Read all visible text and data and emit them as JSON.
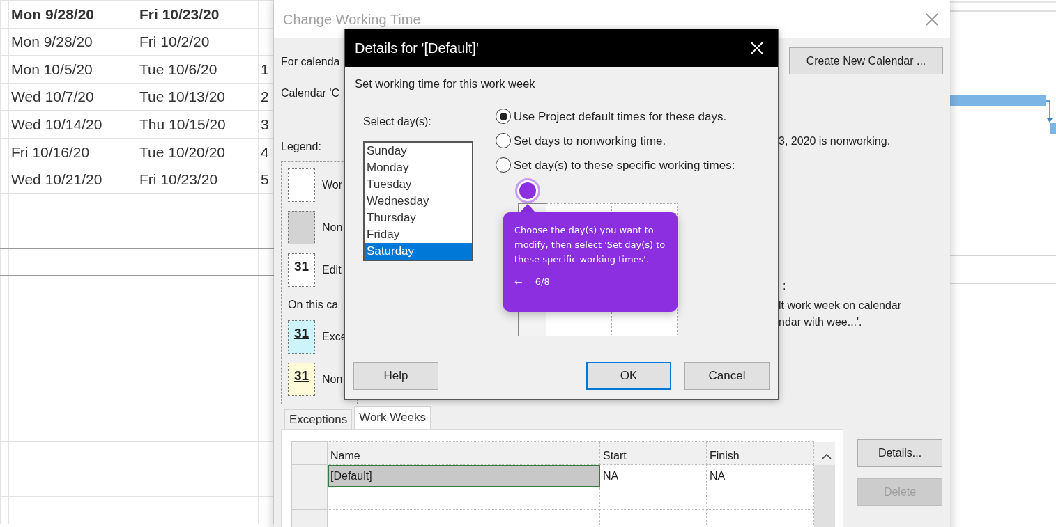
{
  "spreadsheet": {
    "rows": [
      {
        "column_1": "Mon 9/28/20",
        "column_2": "Fri 10/23/20",
        "bold": true
      },
      {
        "column_1": "Mon 9/28/20",
        "column_2": "Fri 10/2/20",
        "bold": false
      },
      {
        "column_1": "Mon 10/5/20",
        "column_2": "Tue 10/6/20",
        "column_3": "1",
        "bold": false
      },
      {
        "column_1": "Wed 10/7/20",
        "column_2": "Tue 10/13/20",
        "column_3": "2",
        "bold": false
      },
      {
        "column_1": "Wed 10/14/20",
        "column_2": "Thu 10/15/20",
        "column_3": "3",
        "bold": false
      },
      {
        "column_1": "Fri 10/16/20",
        "column_2": "Tue 10/20/20",
        "column_3": "4",
        "bold": false
      },
      {
        "column_1": "Wed 10/21/20",
        "column_2": "Fri 10/23/20",
        "column_3": "5",
        "bold": false
      }
    ]
  },
  "change_working_time": {
    "title": "Change Working Time",
    "active": false,
    "for_calendar_label": "For calenda",
    "calendar_note": "Calendar 'C",
    "create_button": "Create New Calendar ...",
    "legend": {
      "title": "Legend:",
      "items": [
        {
          "kind": "working",
          "label": "Wor"
        },
        {
          "kind": "nonworking",
          "label": "Non"
        },
        {
          "kind": "edited",
          "day": "31",
          "label": "Edit"
        }
      ]
    },
    "on_this_calendar": {
      "title": "On this ca",
      "items": [
        {
          "kind": "exception",
          "day": "31",
          "label": "Exce"
        },
        {
          "kind": "nondefault",
          "day": "31",
          "label": "Non"
        }
      ]
    },
    "status_text": "3, 2020 is nonworking.",
    "note_lines": [
      ":",
      "lt work week on calendar",
      "ndar with wee...'."
    ],
    "tabs": [
      {
        "label": "Exceptions",
        "selected": false
      },
      {
        "label": "Work Weeks",
        "selected": true
      }
    ],
    "table": {
      "columns": [
        "Name",
        "Start",
        "Finish"
      ],
      "rows": [
        {
          "name": "[Default]",
          "start": "NA",
          "finish": "NA",
          "selected": true
        }
      ]
    },
    "side_buttons": [
      {
        "label": "Details...",
        "disabled": false
      },
      {
        "label": "Delete",
        "disabled": true
      }
    ]
  },
  "details_dialog": {
    "title": "Details for '[Default]'",
    "section": "Set working time for this work week",
    "select_label": "Select day(s):",
    "days": [
      {
        "label": "Sunday",
        "selected": false
      },
      {
        "label": "Monday",
        "selected": false
      },
      {
        "label": "Tuesday",
        "selected": false
      },
      {
        "label": "Wednesday",
        "selected": false
      },
      {
        "label": "Thursday",
        "selected": false
      },
      {
        "label": "Friday",
        "selected": false
      },
      {
        "label": "Saturday",
        "selected": true
      }
    ],
    "options": [
      {
        "label": "Use Project default times for these days.",
        "selected": true
      },
      {
        "label": "Set days to nonworking time.",
        "selected": false
      },
      {
        "label": "Set day(s) to these specific working times:",
        "selected": false
      }
    ],
    "buttons": [
      {
        "label": "Help",
        "default": false
      },
      {
        "label": "OK",
        "default": true
      },
      {
        "label": "Cancel",
        "default": false
      }
    ]
  },
  "tooltip": {
    "text": "Choose the day(s) you want to modify, then select 'Set day(s) to these specific working times'.",
    "back": "←",
    "step": "6/8"
  }
}
